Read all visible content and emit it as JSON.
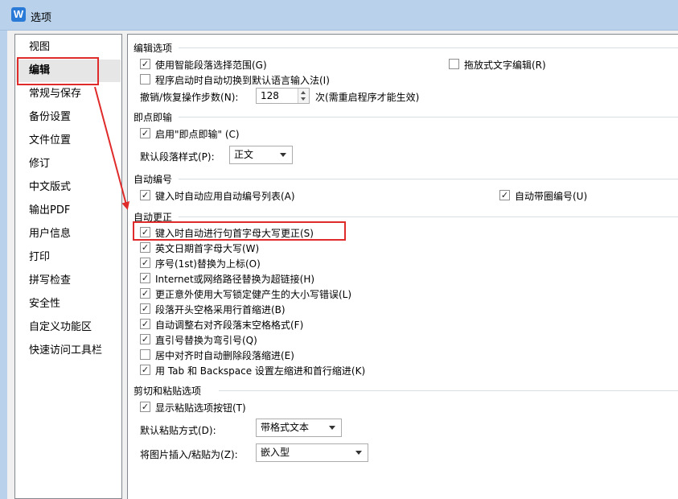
{
  "window": {
    "title": "选项",
    "icon_letter": "W"
  },
  "sidebar": {
    "items": [
      {
        "label": "视图"
      },
      {
        "label": "编辑",
        "selected": true
      },
      {
        "label": "常规与保存"
      },
      {
        "label": "备份设置"
      },
      {
        "label": "文件位置"
      },
      {
        "label": "修订"
      },
      {
        "label": "中文版式"
      },
      {
        "label": "输出PDF"
      },
      {
        "label": "用户信息"
      },
      {
        "label": "打印"
      },
      {
        "label": "拼写检查"
      },
      {
        "label": "安全性"
      },
      {
        "label": "自定义功能区"
      },
      {
        "label": "快速访问工具栏"
      }
    ]
  },
  "edit_options": {
    "title": "编辑选项",
    "smart_select": {
      "label": "使用智能段落选择范围(G)",
      "checked": true
    },
    "drag_edit": {
      "label": "拖放式文字编辑(R)",
      "checked": false
    },
    "auto_ime": {
      "label": "程序启动时自动切换到默认语言输入法(I)",
      "checked": false
    },
    "undo_steps": {
      "label": "撤销/恢复操作步数(N):",
      "value": "128",
      "suffix": "次(需重启程序才能生效)"
    }
  },
  "click_and_type": {
    "title": "即点即输",
    "enable": {
      "label": "启用\"即点即输\" (C)",
      "checked": true
    },
    "default_style": {
      "label": "默认段落样式(P):",
      "value": "正文"
    }
  },
  "auto_number": {
    "title": "自动编号",
    "auto_list": {
      "label": "键入时自动应用自动编号列表(A)",
      "checked": true
    },
    "auto_circle": {
      "label": "自动带圈编号(U)",
      "checked": true
    }
  },
  "auto_correct": {
    "title": "自动更正",
    "items": [
      {
        "label": "键入时自动进行句首字母大写更正(S)",
        "checked": true
      },
      {
        "label": "英文日期首字母大写(W)",
        "checked": true
      },
      {
        "label": "序号(1st)替换为上标(O)",
        "checked": true
      },
      {
        "label": "Internet或网络路径替换为超链接(H)",
        "checked": true
      },
      {
        "label": "更正意外使用大写锁定健产生的大小写错误(L)",
        "checked": true
      },
      {
        "label": "段落开头空格采用行首缩进(B)",
        "checked": true
      },
      {
        "label": "自动调整右对齐段落末空格格式(F)",
        "checked": true
      },
      {
        "label": "直引号替换为弯引号(Q)",
        "checked": true
      },
      {
        "label": "居中对齐时自动删除段落缩进(E)",
        "checked": false
      },
      {
        "label": "用 Tab 和 Backspace 设置左缩进和首行缩进(K)",
        "checked": true
      }
    ]
  },
  "paste_options": {
    "title": "剪切和粘贴选项",
    "show_button": {
      "label": "显示粘贴选项按钮(T)",
      "checked": true
    },
    "default_paste": {
      "label": "默认粘贴方式(D):",
      "value": "带格式文本"
    },
    "image_insert": {
      "label": "将图片插入/粘贴为(Z):",
      "value": "嵌入型"
    }
  },
  "colors": {
    "highlight": "#e02b2b",
    "titlebar": "#b9d1ea",
    "accent": "#2a7ad8"
  }
}
